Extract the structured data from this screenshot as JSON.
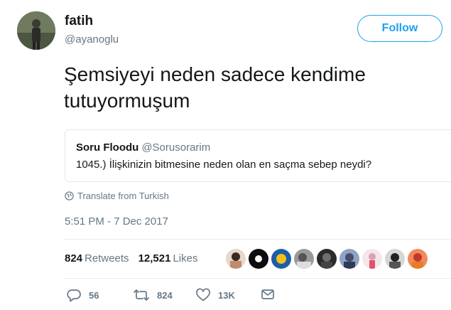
{
  "author": {
    "name": "fatih",
    "handle": "@ayanoglu",
    "avatar_icon": "profile-photo"
  },
  "follow_label": "Follow",
  "tweet": {
    "line1": "Şemsiyeyi neden sadece kendime",
    "line2": "tutuyormuşum"
  },
  "quote": {
    "name": "Soru Floodu",
    "handle": "@Sorusorarim",
    "text": "1045.) İlişkinizin bitmesine neden olan en saçma sebep neydi?"
  },
  "translate_label": "Translate from Turkish",
  "timestamp": "5:51 PM - 7 Dec 2017",
  "stats": {
    "retweets_count": "824",
    "retweets_label": "Retweets",
    "likes_count": "12,521",
    "likes_label": "Likes"
  },
  "actions": {
    "reply_count": "56",
    "retweet_count": "824",
    "like_count": "13K"
  },
  "colors": {
    "accent": "#1da1f2",
    "secondary_text": "#657786",
    "border": "#e1e8ed"
  }
}
